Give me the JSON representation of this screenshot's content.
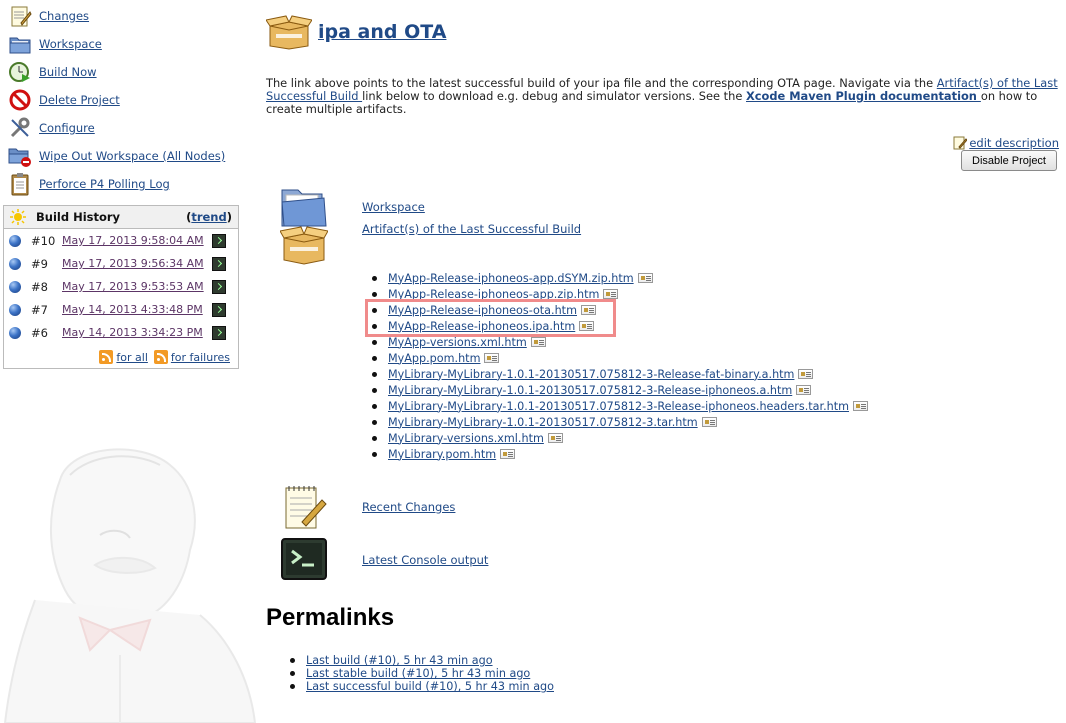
{
  "sidebar": {
    "tasks": [
      {
        "label": "Changes",
        "icon": "notepad-icon"
      },
      {
        "label": "Workspace",
        "icon": "folder-icon"
      },
      {
        "label": "Build Now",
        "icon": "clock-play-icon"
      },
      {
        "label": "Delete Project",
        "icon": "no-entry-icon"
      },
      {
        "label": "Configure",
        "icon": "wrench-icon"
      },
      {
        "label": "Wipe Out Workspace (All Nodes)",
        "icon": "folder-delete-icon"
      },
      {
        "label": "Perforce P4 Polling Log",
        "icon": "clipboard-icon"
      }
    ]
  },
  "build_history": {
    "title": "Build History",
    "trend_open": "(",
    "trend_label": "trend",
    "trend_close": ")",
    "builds": [
      {
        "number": "#10",
        "date": "May 17, 2013 9:58:04 AM",
        "status": "blue"
      },
      {
        "number": "#9",
        "date": "May 17, 2013 9:56:34 AM",
        "status": "blue"
      },
      {
        "number": "#8",
        "date": "May 17, 2013 9:53:53 AM",
        "status": "blue"
      },
      {
        "number": "#7",
        "date": "May 14, 2013 4:33:48 PM",
        "status": "blue"
      },
      {
        "number": "#6",
        "date": "May 14, 2013 3:34:23 PM",
        "status": "blue"
      }
    ],
    "rss_all": "for all",
    "rss_failures": "for failures"
  },
  "main": {
    "title": "ipa and OTA",
    "description": {
      "part1": "The link above points to the latest successful build of your ipa file and the corresponding OTA page. Navigate via the ",
      "link1": "Artifact(s) of the Last Successful Build ",
      "part2": "link below to download e.g. debug and simulator versions. See the ",
      "link2": "Xcode Maven Plugin documentation ",
      "part3": "on how to create multiple artifacts."
    },
    "edit_description": "edit description",
    "disable_button": "Disable Project",
    "workspace_link": "Workspace",
    "artifacts_link": "Artifact(s) of the Last Successful Build",
    "artifacts": [
      "MyApp-Release-iphoneos-app.dSYM.zip.htm",
      "MyApp-Release-iphoneos-app.zip.htm",
      "MyApp-Release-iphoneos-ota.htm",
      "MyApp-Release-iphoneos.ipa.htm",
      "MyApp-versions.xml.htm",
      "MyApp.pom.htm",
      "MyLibrary-MyLibrary-1.0.1-20130517.075812-3-Release-fat-binary.a.htm",
      "MyLibrary-MyLibrary-1.0.1-20130517.075812-3-Release-iphoneos.a.htm",
      "MyLibrary-MyLibrary-1.0.1-20130517.075812-3-Release-iphoneos.headers.tar.htm",
      "MyLibrary-MyLibrary-1.0.1-20130517.075812-3.tar.htm",
      "MyLibrary-versions.xml.htm",
      "MyLibrary.pom.htm"
    ],
    "recent_changes_link": "Recent Changes",
    "console_link": "Latest Console output",
    "permalinks_title": "Permalinks",
    "permalinks": [
      "Last build (#10), 5 hr 43 min ago",
      "Last stable build (#10), 5 hr 43 min ago",
      "Last successful build (#10), 5 hr 43 min ago"
    ]
  },
  "colors": {
    "link": "#204a87",
    "highlight": "#f08b8b",
    "visited": "#5c3566"
  }
}
